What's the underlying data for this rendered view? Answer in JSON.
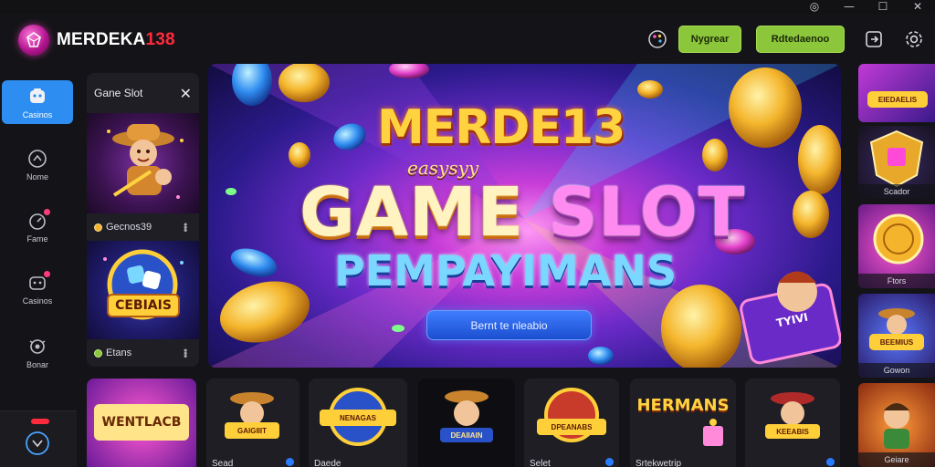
{
  "window": {
    "settings_glyph": "◎",
    "minimize_glyph": "—",
    "maximize_glyph": "☐",
    "close_glyph": "✕"
  },
  "brand": {
    "name_white": "MERDEKA",
    "name_red": "138"
  },
  "header": {
    "login_label": "Nygrear",
    "register_label": "Rdtedaenoo"
  },
  "sidebar": {
    "items": [
      {
        "label": "Casinos",
        "icon": "casino-icon"
      },
      {
        "label": "Nome",
        "icon": "home-icon"
      },
      {
        "label": "Fame",
        "icon": "fame-icon"
      },
      {
        "label": "Casinos",
        "icon": "casino-icon"
      },
      {
        "label": "Bonar",
        "icon": "bonus-icon"
      }
    ]
  },
  "slot_panel": {
    "title": "Gane Slot",
    "close_glyph": "✕",
    "games": [
      {
        "label": "Gecnos39"
      },
      {
        "label": "Etans",
        "art_text": "CEBIAIS"
      }
    ]
  },
  "hero": {
    "line1": "MERDE13",
    "line1b": "easysyy",
    "line2a": "GAME",
    "line2b": "SLOT",
    "line3": "PEMPAYIMANS",
    "sign_text": "TYIVI",
    "cta_label": "Bernt te nleabio"
  },
  "right_column": [
    {
      "label": "",
      "art_text": "EIEDAELIS"
    },
    {
      "label": "Scador"
    },
    {
      "label": "Ftors"
    },
    {
      "label": "Gowon",
      "art_text": "BEEMIUS"
    },
    {
      "label": "Geiare"
    }
  ],
  "bottom_row": [
    {
      "label": "",
      "art_text": "WENTLACB"
    },
    {
      "label": "Sead",
      "art_text": "GAIGIIIT"
    },
    {
      "label": "Daede",
      "art_text": "NENAGAS"
    },
    {
      "label": "",
      "art_text": "DEAIIAIN"
    },
    {
      "label": "Selet",
      "art_text": "DPEANABS"
    },
    {
      "label": "Srtekwetrip",
      "art_text": "HERMANS"
    },
    {
      "label": "",
      "art_text": "KEEABIS"
    }
  ],
  "colors": {
    "background": "#141418",
    "accent_green": "#8cc63a",
    "accent_blue": "#2d8df0",
    "brand_red": "#ff2a3c",
    "panel": "#1e1e24"
  }
}
